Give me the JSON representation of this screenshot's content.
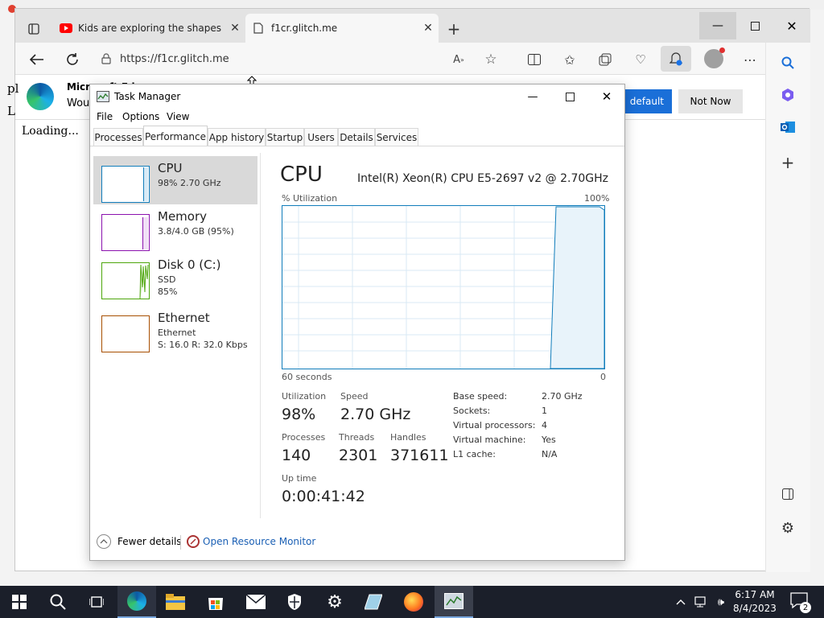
{
  "browser": {
    "tabs": [
      {
        "title": "Kids are exploring the shapes at t"
      },
      {
        "title": "f1cr.glitch.me"
      }
    ],
    "url": "https://f1cr.glitch.me",
    "notification": {
      "title": "Microsoft Edge",
      "body_prefix": "Wou",
      "set_default_label": "default",
      "not_now_label": "Not Now"
    },
    "page": {
      "loading_text": "Loading...",
      "side_text_1": "pl",
      "side_text_2": "L"
    }
  },
  "task_manager": {
    "title": "Task Manager",
    "menu": [
      "File",
      "Options",
      "View"
    ],
    "tabs": [
      "Processes",
      "Performance",
      "App history",
      "Startup",
      "Users",
      "Details",
      "Services"
    ],
    "resources": [
      {
        "name": "CPU",
        "line1": "98%  2.70 GHz",
        "line2": "",
        "color": "#117dbb"
      },
      {
        "name": "Memory",
        "line1": "3.8/4.0 GB (95%)",
        "line2": "",
        "color": "#8b12ae"
      },
      {
        "name": "Disk 0 (C:)",
        "line1": "SSD",
        "line2": "85%",
        "color": "#4da60c"
      },
      {
        "name": "Ethernet",
        "line1": "Ethernet",
        "line2": "S: 16.0  R: 32.0 Kbps",
        "color": "#a74f01"
      }
    ],
    "cpu": {
      "heading": "CPU",
      "model": "Intel(R) Xeon(R) CPU E5-2697 v2 @ 2.70GHz",
      "graph_label": "% Utilization",
      "graph_max": "100%",
      "graph_time": "60 seconds",
      "graph_min": "0",
      "stats": {
        "utilization_label": "Utilization",
        "utilization": "98%",
        "speed_label": "Speed",
        "speed": "2.70 GHz",
        "processes_label": "Processes",
        "processes": "140",
        "threads_label": "Threads",
        "threads": "2301",
        "handles_label": "Handles",
        "handles": "371611",
        "uptime_label": "Up time",
        "uptime": "0:00:41:42"
      },
      "details": [
        {
          "k": "Base speed:",
          "v": "2.70 GHz"
        },
        {
          "k": "Sockets:",
          "v": "1"
        },
        {
          "k": "Virtual processors:",
          "v": "4"
        },
        {
          "k": "Virtual machine:",
          "v": "Yes"
        },
        {
          "k": "L1 cache:",
          "v": "N/A"
        }
      ]
    },
    "footer": {
      "fewer_details": "Fewer details",
      "resource_monitor": "Open Resource Monitor"
    }
  },
  "taskbar": {
    "time": "6:17 AM",
    "date": "8/4/2023",
    "notifications": "2"
  },
  "colors": {
    "cpu_accent": "#117dbb",
    "edge_blue": "#1a73e8",
    "taskbar_bg": "#1b1f2a"
  }
}
